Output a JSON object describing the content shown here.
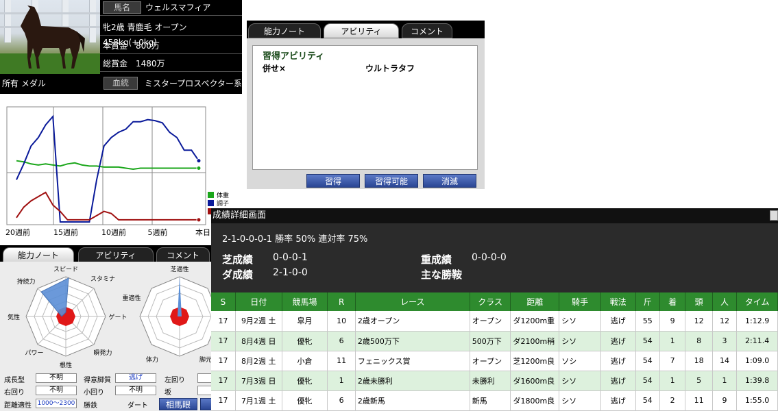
{
  "horse": {
    "name_label": "馬名",
    "name": "ウェルスマフィア",
    "profile": "牝2歳 青鹿毛 オープン 458kg(+0kg)",
    "main_prize_label": "本賞金",
    "main_prize": "800万",
    "total_prize_label": "総賞金",
    "total_prize": "1480万",
    "owner": "所有 メダル",
    "pedigree_button": "血統",
    "sire_line": "ミスタープロスペクター系"
  },
  "graph": {
    "x_labels": [
      "20週前",
      "15週前",
      "10週前",
      "5週前",
      "本日"
    ],
    "legend": [
      {
        "label": "体重",
        "color": "#1aa61a"
      },
      {
        "label": "調子",
        "color": "#0a1a9a"
      },
      {
        "label": "",
        "color": "#a01010"
      }
    ],
    "series": {
      "weight": [
        58,
        57,
        55,
        54,
        55,
        54,
        53,
        55,
        56,
        54,
        53,
        53,
        52,
        52,
        52,
        51,
        50,
        51,
        51,
        51,
        51,
        51,
        51,
        51,
        51,
        51
      ],
      "condition": [
        40,
        55,
        72,
        80,
        92,
        100,
        0,
        0,
        0,
        0,
        0,
        40,
        72,
        80,
        85,
        88,
        95,
        95,
        97,
        96,
        94,
        85,
        80,
        68,
        68,
        58
      ],
      "other": [
        4,
        14,
        20,
        24,
        28,
        16,
        10,
        2,
        2,
        2,
        2,
        6,
        10,
        8,
        2,
        2,
        2,
        2,
        2,
        2,
        2,
        2,
        2,
        2,
        2,
        2
      ]
    }
  },
  "ability_tabs_left": [
    "能力ノート",
    "アビリティ",
    "コメント"
  ],
  "radar_left": {
    "labels": [
      "スピード",
      "スタミナ",
      "ゲート",
      "瞬発力",
      "根性",
      "パワー",
      "気性",
      "持続力"
    ]
  },
  "radar_right": {
    "labels": [
      "芝適性",
      "重適性",
      "体力",
      "脚元"
    ]
  },
  "stats": {
    "growth_label": "成長型",
    "growth": "不明",
    "tactic_label": "得意脚質",
    "tactic": "逃げ",
    "left_turn_label": "左回り",
    "right_turn_label": "右回り",
    "right_turn": "不明",
    "small_turn_label": "小回り",
    "small_turn": "不明",
    "slope_label": "坂",
    "distance_label": "距離適性",
    "distance": "1000～2300",
    "surface_label": "勝鉄",
    "surface": "ダート",
    "eye_button": "相馬眼"
  },
  "ability_window": {
    "tabs": [
      "能力ノート",
      "アビリティ",
      "コメント"
    ],
    "section_title": "習得アビリティ",
    "abilities": [
      "併せ×",
      "ウルトラタフ"
    ],
    "buttons": [
      "習得",
      "習得可能",
      "消滅"
    ]
  },
  "detail": {
    "title": "成績詳細画面",
    "summary": "2-1-0-0-0-1 勝率 50% 連対率 75%",
    "turf_label": "芝成績",
    "turf": "0-0-0-1",
    "heavy_label": "重成績",
    "heavy": "0-0-0-0",
    "dirt_label": "ダ成績",
    "dirt": "2-1-0-0",
    "main_training_label": "主な勝鞍",
    "columns": [
      "S",
      "日付",
      "競馬場",
      "R",
      "レース",
      "クラス",
      "距離",
      "騎手",
      "戦法",
      "斤",
      "着",
      "頭",
      "人",
      "タイム"
    ],
    "rows": [
      [
        "17",
        "9月2週 土",
        "皐月",
        "10",
        "2歳オープン",
        "オープン",
        "ダ1200m重",
        "シソ",
        "逃げ",
        "55",
        "9",
        "12",
        "12",
        "1:12.9"
      ],
      [
        "17",
        "8月4週 日",
        "優牝",
        "6",
        "2歳500万下",
        "500万下",
        "ダ2100m稍",
        "シソ",
        "逃げ",
        "54",
        "1",
        "8",
        "3",
        "2:11.4"
      ],
      [
        "17",
        "8月2週 土",
        "小倉",
        "11",
        "フェニックス賞",
        "オープン",
        "芝1200m良",
        "ソシ",
        "逃げ",
        "54",
        "7",
        "18",
        "14",
        "1:09.0"
      ],
      [
        "17",
        "7月3週 日",
        "優牝",
        "1",
        "2歳未勝利",
        "未勝利",
        "ダ1600m良",
        "シソ",
        "逃げ",
        "54",
        "1",
        "5",
        "1",
        "1:39.8"
      ],
      [
        "17",
        "7月1週 土",
        "優牝",
        "6",
        "2歳新馬",
        "新馬",
        "ダ1800m良",
        "シソ",
        "逃げ",
        "54",
        "2",
        "11",
        "9",
        "1:55.0"
      ]
    ]
  }
}
